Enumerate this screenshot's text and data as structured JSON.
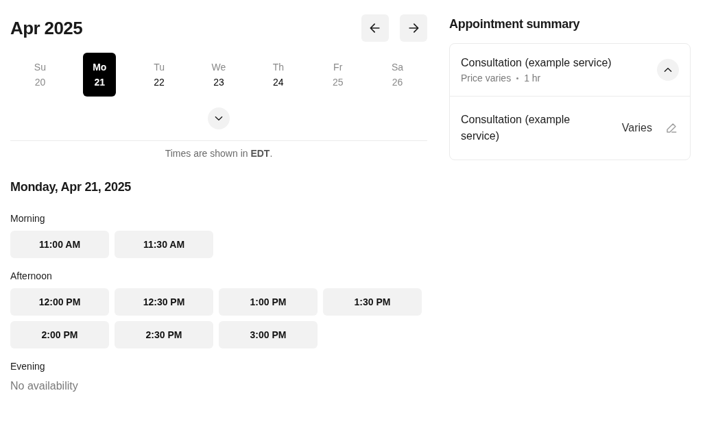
{
  "calendar": {
    "month": "Apr 2025",
    "week_view_expanded": false,
    "days": [
      {
        "weekday": "Su",
        "date": "20",
        "selected": false,
        "available": false
      },
      {
        "weekday": "Mo",
        "date": "21",
        "selected": true,
        "available": true
      },
      {
        "weekday": "Tu",
        "date": "22",
        "selected": false,
        "available": true
      },
      {
        "weekday": "We",
        "date": "23",
        "selected": false,
        "available": true
      },
      {
        "weekday": "Th",
        "date": "24",
        "selected": false,
        "available": true
      },
      {
        "weekday": "Fr",
        "date": "25",
        "selected": false,
        "available": false
      },
      {
        "weekday": "Sa",
        "date": "26",
        "selected": false,
        "available": false
      }
    ],
    "timezone_note": "Times are shown in **EDT**."
  },
  "schedule": {
    "date_heading": "Monday, Apr 21, 2025",
    "periods": [
      {
        "label": "Morning",
        "slots": [
          "11:00 AM",
          "11:30 AM"
        ]
      },
      {
        "label": "Afternoon",
        "slots": [
          "12:00 PM",
          "12:30 PM",
          "1:00 PM",
          "1:30 PM",
          "2:00 PM",
          "2:30 PM",
          "3:00 PM"
        ]
      },
      {
        "label": "Evening",
        "empty_note": "No availability"
      }
    ]
  },
  "summary": {
    "title": "Appointment summary",
    "service": {
      "name": "Consultation (example service)",
      "details": [
        "Price varies",
        "1 hr"
      ],
      "expanded": true
    },
    "items": [
      {
        "name": "Consultation (example service)",
        "price": "Varies"
      }
    ]
  }
}
